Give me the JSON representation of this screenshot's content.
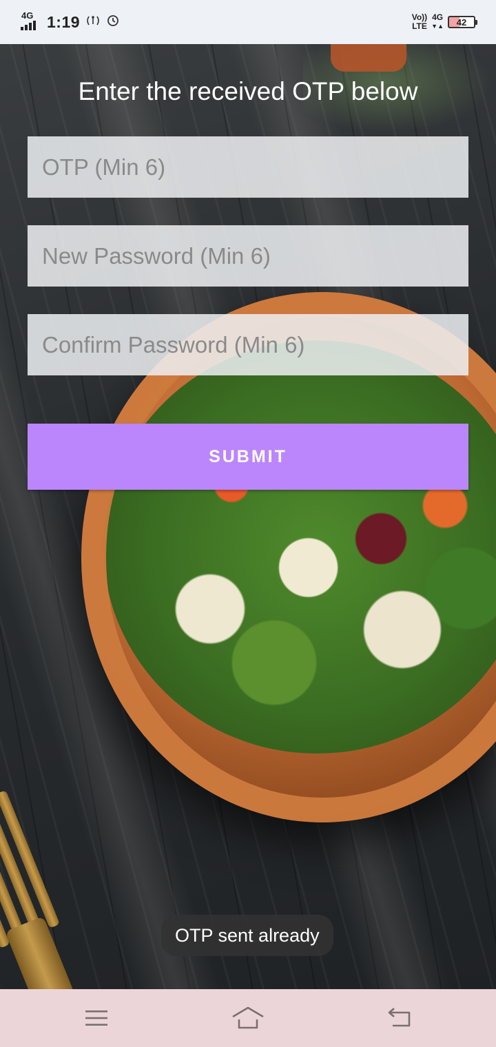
{
  "status_bar": {
    "network_type": "4G",
    "time": "1:19",
    "volte_label": "Vo))",
    "lte_label": "LTE",
    "network_type_right": "4G",
    "battery_level": "42",
    "icons": [
      "signal-icon",
      "hotspot-icon",
      "alarm-icon",
      "data-arrows-icon",
      "battery-icon"
    ]
  },
  "form": {
    "title": "Enter the received OTP below",
    "otp_placeholder": "OTP (Min 6)",
    "otp_value": "",
    "new_password_placeholder": "New Password (Min 6)",
    "new_password_value": "",
    "confirm_password_placeholder": "Confirm Password (Min 6)",
    "confirm_password_value": "",
    "submit_label": "SUBMIT"
  },
  "toast": {
    "message": "OTP sent already"
  },
  "nav_bar": {
    "icons": [
      "menu-icon",
      "home-icon",
      "back-icon"
    ]
  },
  "colors": {
    "accent": "#bb86fc",
    "status_bar_bg": "#eef1f5",
    "nav_bar_bg": "#ecd5d9",
    "battery_fill": "#f3a3a3"
  }
}
